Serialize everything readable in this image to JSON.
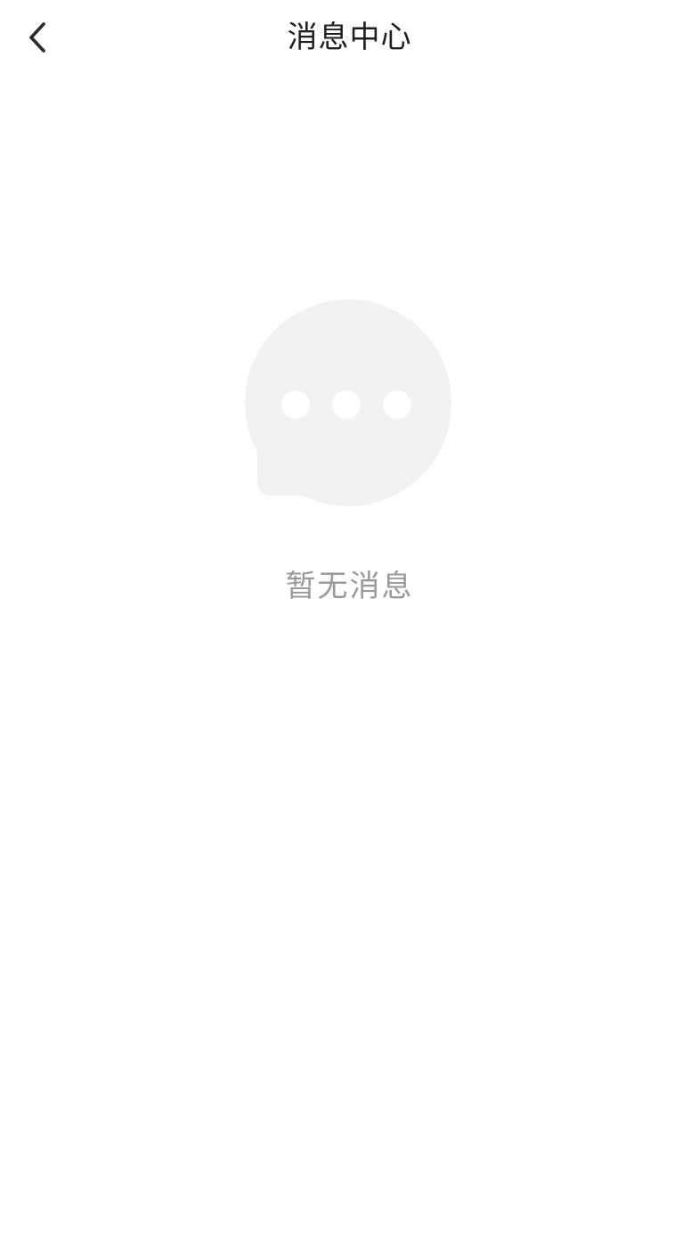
{
  "header": {
    "title": "消息中心",
    "back_icon": "chevron-left-icon"
  },
  "empty_state": {
    "icon": "chat-bubble-icon",
    "message": "暂无消息"
  },
  "colors": {
    "background": "#ffffff",
    "title_text": "#1f1f1f",
    "empty_text": "#9a9a9a",
    "icon_fill": "#f2f2f2"
  }
}
